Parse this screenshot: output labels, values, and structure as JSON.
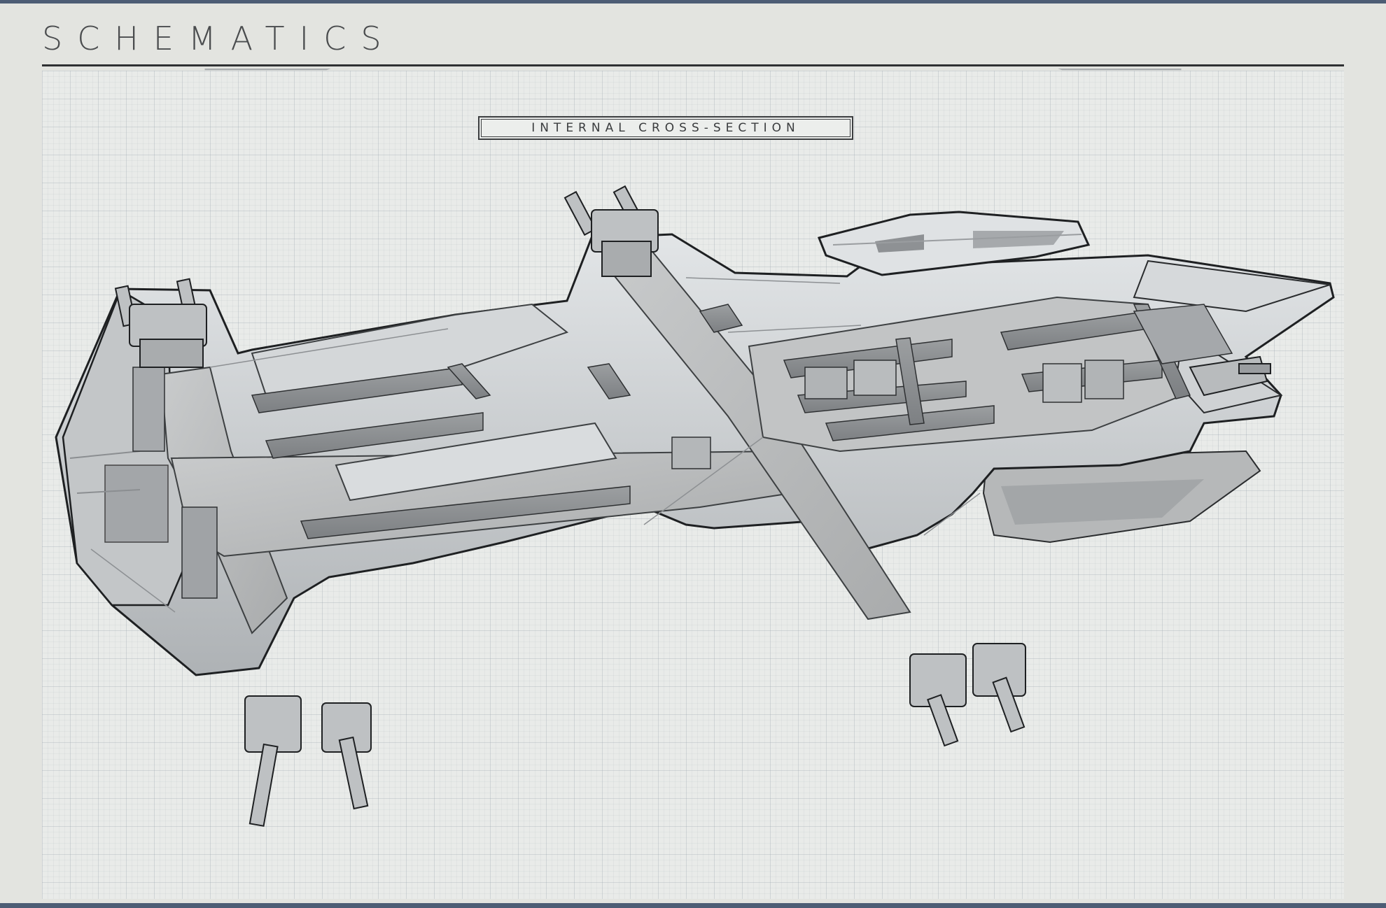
{
  "header": {
    "title": "SCHEMATICS"
  },
  "panel": {
    "label": "INTERNAL CROSS-SECTION"
  },
  "colors": {
    "frame_border": "#4d5d75",
    "background": "#e3e4e0",
    "grid_background": "#e9ebe9",
    "ink": "#2f3133",
    "hull": "#c8cbcd",
    "hull_shadow": "#9a9c9e",
    "floor": "#b9bbbc"
  }
}
